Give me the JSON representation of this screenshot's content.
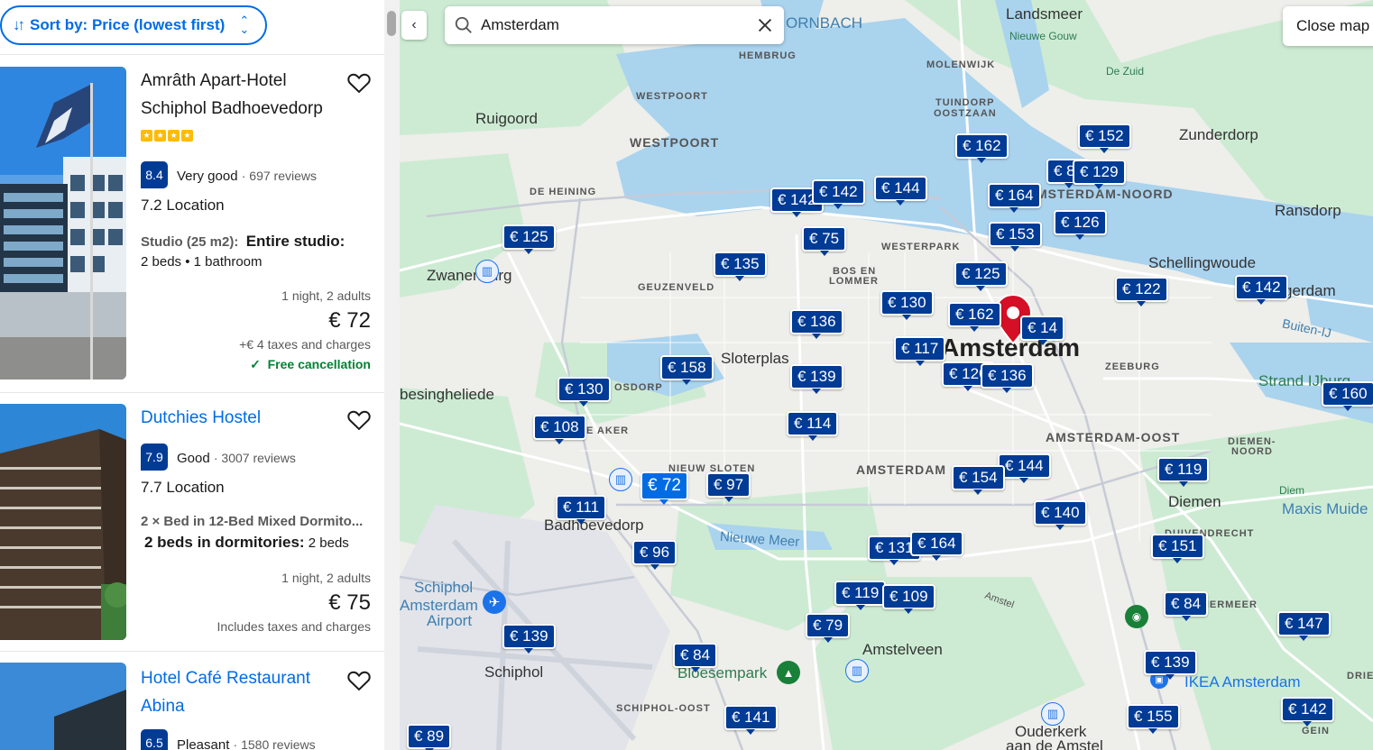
{
  "sort": {
    "label": "Sort by: Price (lowest first)"
  },
  "listings": [
    {
      "name": "Amrâth Apart-Hotel Schiphol Badhoevedorp",
      "stars": 4,
      "score": "8.4",
      "score_word": "Very good",
      "reviews": "· 697 reviews",
      "location": "7.2 Location",
      "room_type": "Studio (25 m2):",
      "room_name": "Entire studio:",
      "room_detail": "2 beds • 1 bathroom",
      "nights": "1 night, 2 adults",
      "price": "€ 72",
      "taxes": "+€ 4 taxes and charges",
      "cancellation": "Free cancellation"
    },
    {
      "name": "Dutchies Hostel",
      "score": "7.9",
      "score_word": "Good",
      "reviews": "· 3007 reviews",
      "location": "7.7 Location",
      "room_type": "2 × Bed in 12-Bed Mixed Dormito...",
      "room_name": "2 beds in dormitories:",
      "room_detail": "2 beds",
      "nights": "1 night, 2 adults",
      "price": "€ 75",
      "taxes": "Includes taxes and charges"
    },
    {
      "name": "Hotel Café Restaurant Abina",
      "score": "6.5",
      "score_word": "Pleasant",
      "reviews": "· 1580 reviews"
    }
  ],
  "map": {
    "search_value": "Amsterdam",
    "close_label": "Close map",
    "places": {
      "landsmeer": "Landsmeer",
      "nieuwe_gouw": "Nieuwe Gouw",
      "de_zuid": "De Zuid",
      "hembrug": "HEMBRUG",
      "molenwijk": "MOLENWIJK",
      "tuindorp": "TUINDORP",
      "oostzaan": "OOSTZAAN",
      "ruigoord": "Ruigoord",
      "westpoort_sm": "WESTPOORT",
      "westpoort": "WESTPOORT",
      "zunderdorp": "Zunderdorp",
      "de_heining": "DE HEINING",
      "amsterdam_noord": "MSTERDAM-NOORD",
      "ransdorp": "Ransdorp",
      "westerpark": "WESTERPARK",
      "bos_en": "BOS EN",
      "lommer": "LOMMER",
      "schellingwoude": "Schellingwoude",
      "zwanenburg": "Zwanenburg",
      "geuzenveld": "GEUZENVELD",
      "durgerdam": "gerdam",
      "buiten_ij": "Buiten-IJ",
      "amsterdam": "Amsterdam",
      "zeeburg": "ZEEBURG",
      "strand_ijburg": "Strand IJburg",
      "osdorp": "OSDORP",
      "sloterplas": "Sloterplas",
      "halfweg": "besingheliede",
      "de_aker": "DE AKER",
      "amsterdam_oost": "AMSTERDAM-OOST",
      "diemen_noord": "DIEMEN-",
      "diemen_noord2": "NOORD",
      "nieuw_sloten": "NIEUW SLOTEN",
      "amsterdam_mid": "AMSTERDAM",
      "diemen": "Diemen",
      "diem": "Diem",
      "maxis": "Maxis Muide",
      "badhoevedorp": "Badhoevedorp",
      "nieuwe_meer": "Nieuwe Meer",
      "duivendrecht": "DUIVENDRECHT",
      "schiphol_airport": "Schiphol",
      "schiphol_airport2": "Amsterdam",
      "schiphol_airport3": "Airport",
      "amstel": "Amstel",
      "bijlmermeer": "LMERMEER",
      "amstelveen": "Amstelveen",
      "schiphol": "Schiphol",
      "bloesempark": "Bloesempark",
      "ikea": "IKEA Amsterdam",
      "driemond": "DRIE",
      "schiphol_oost": "SCHIPHOL-OOST",
      "ouderkerk": "Ouderkerk",
      "ouderkerk2": "aan de Amstel",
      "gein": "GEIN",
      "ornbach": "ORNBACH"
    },
    "pins": [
      "€ 162",
      "€ 152",
      "€ 84",
      "€ 129",
      "€ 142",
      "€ 142",
      "€ 144",
      "€ 164",
      "€ 126",
      "€ 125",
      "€ 75",
      "€ 153",
      "€ 135",
      "€ 125",
      "€ 122",
      "€ 142",
      "€ 130",
      "€ 162",
      "€ 14",
      "€ 136",
      "€ 117",
      "€ 120",
      "€ 136",
      "€ 158",
      "€ 139",
      "€ 160",
      "€ 130",
      "€ 108",
      "€ 114",
      "€ 119",
      "€ 144",
      "€ 154",
      "€ 72",
      "€ 97",
      "€ 111",
      "€ 140",
      "€ 96",
      "€ 131",
      "€ 164",
      "€ 151",
      "€ 119",
      "€ 109",
      "€ 84",
      "€ 79",
      "€ 147",
      "€ 139",
      "€ 84",
      "€ 139",
      "€ 141",
      "€ 155",
      "€ 142",
      "€ 89"
    ]
  },
  "colors": {
    "accent": "#006ce4",
    "pin": "#003b95",
    "score": "#003b95",
    "green": "#008234",
    "star": "#febb02"
  }
}
